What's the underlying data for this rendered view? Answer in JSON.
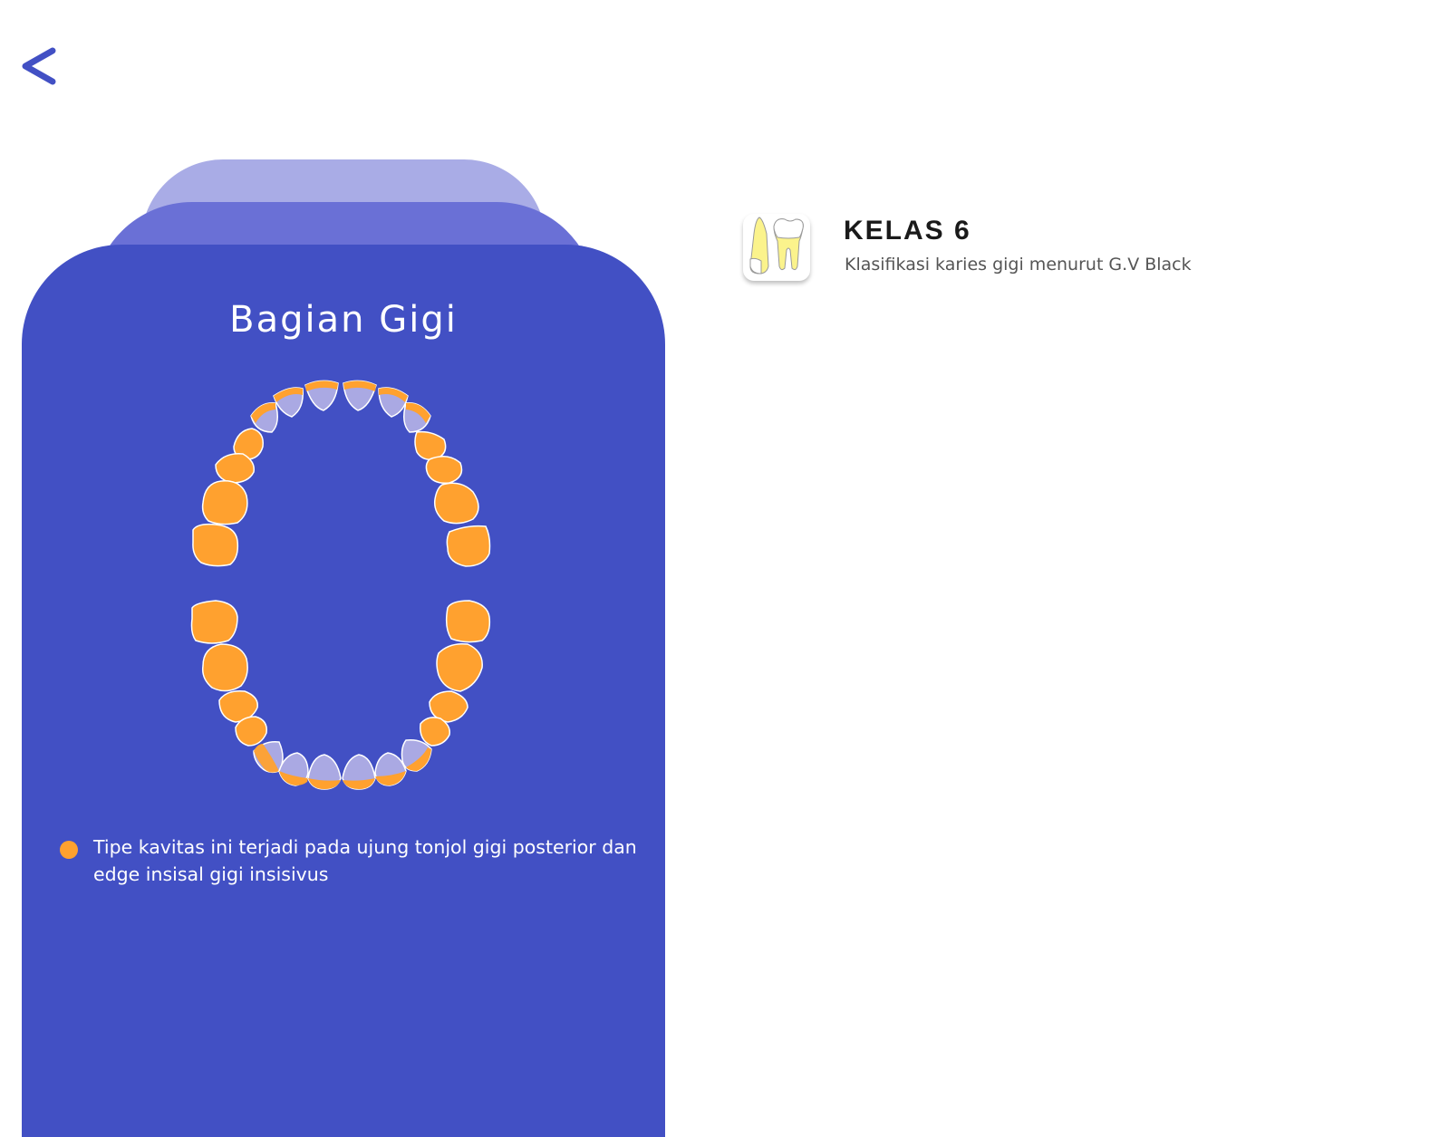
{
  "navigation": {
    "back_icon": "chevron-left-icon"
  },
  "panel": {
    "title": "Bagian Gigi",
    "figure": "dental-arch-diagram"
  },
  "legend": {
    "color": "#ffa12f",
    "text": "Tipe kavitas ini terjadi pada ujung tonjol gigi posterior dan edge insisal gigi insisivus"
  },
  "header": {
    "icon": "tooth-icon",
    "title": "KELAS 6",
    "subtitle": "Klasifikasi karies gigi menurut G.V Black"
  },
  "colors": {
    "accent": "#4250c4",
    "tab_middle": "#6a70d6",
    "tab_back": "#a9ace6",
    "highlight": "#ffa12f",
    "tooth_base": "#aaa9e3"
  }
}
